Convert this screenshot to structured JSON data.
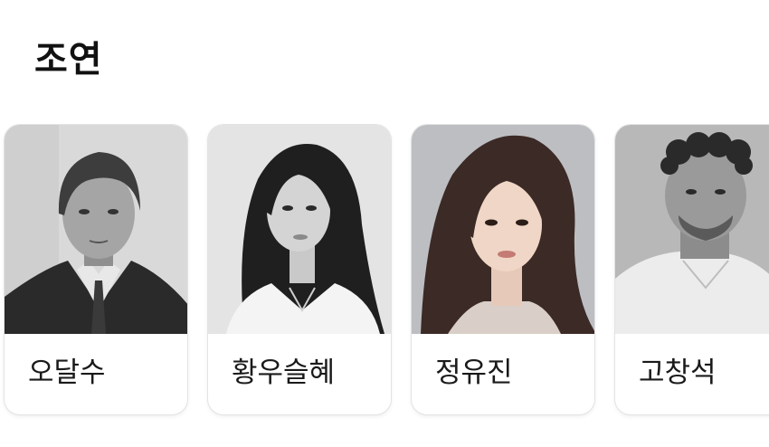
{
  "section": {
    "title": "조연"
  },
  "cast": [
    {
      "name": "오달수",
      "photo_icon": "actor-portrait-bw"
    },
    {
      "name": "황우슬혜",
      "photo_icon": "actress-portrait-bw"
    },
    {
      "name": "정유진",
      "photo_icon": "actress-portrait-color"
    },
    {
      "name": "고창석",
      "photo_icon": "actor-portrait-bw"
    }
  ],
  "colors": {
    "card_border": "#e3e3e3",
    "title_text": "#111111",
    "name_text": "#1a1a1a"
  }
}
